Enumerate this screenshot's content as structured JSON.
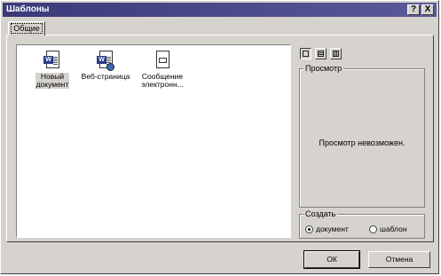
{
  "window": {
    "title": "Шаблоны",
    "help_btn": "?",
    "close_btn": "X"
  },
  "tabs": [
    {
      "label": "Общие",
      "active": true
    }
  ],
  "templates": [
    {
      "label_line1": "Новый",
      "label_line2": "документ",
      "icon": "word-document-icon",
      "selected": true
    },
    {
      "label_line1": "Веб-страница",
      "label_line2": "",
      "icon": "word-webpage-icon",
      "selected": false
    },
    {
      "label_line1": "Сообщение",
      "label_line2": "электронн...",
      "icon": "email-message-icon",
      "selected": false
    }
  ],
  "view_buttons": [
    "large-icons",
    "list",
    "details"
  ],
  "preview": {
    "label": "Просмотр",
    "message": "Просмотр невозможен."
  },
  "create": {
    "label": "Создать",
    "options": [
      {
        "label": "документ",
        "checked": true
      },
      {
        "label": "шаблон",
        "checked": false
      }
    ]
  },
  "buttons": {
    "ok": "ОК",
    "cancel": "Отмена"
  }
}
